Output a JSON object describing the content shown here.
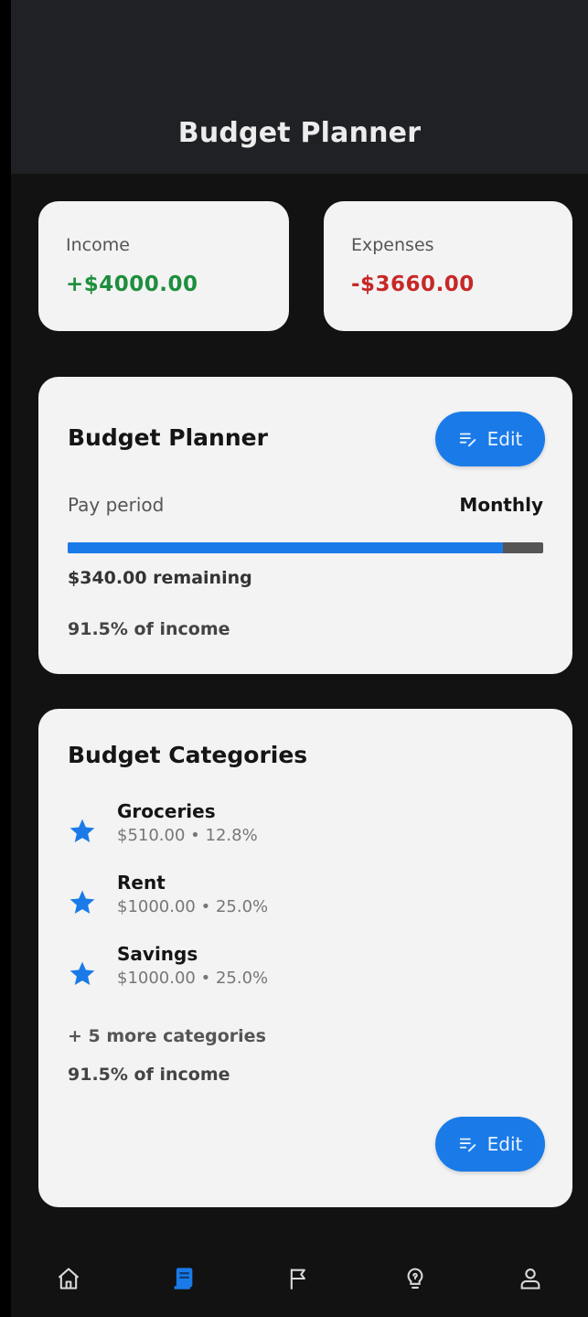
{
  "header": {
    "title": "Budget Planner"
  },
  "summary": {
    "income": {
      "label": "Income",
      "value": "+$4000.00",
      "color": "#1e8e3e"
    },
    "expenses": {
      "label": "Expenses",
      "value": "-$3660.00",
      "color": "#c62828"
    }
  },
  "planner": {
    "title": "Budget Planner",
    "edit_label": "Edit",
    "pay_period_label": "Pay period",
    "pay_period_value": "Monthly",
    "progress_fraction": 0.915,
    "remaining": "$340.00 remaining",
    "percent_of_income": "91.5% of income"
  },
  "categories": {
    "title": "Budget Categories",
    "items": [
      {
        "name": "Groceries",
        "detail": "$510.00 • 12.8%",
        "icon": "star-icon"
      },
      {
        "name": "Rent",
        "detail": "$1000.00 • 25.0%",
        "icon": "star-icon"
      },
      {
        "name": "Savings",
        "detail": "$1000.00 • 25.0%",
        "icon": "star-icon"
      }
    ],
    "more": "+ 5 more categories",
    "percent_of_income": "91.5% of income",
    "edit_label": "Edit"
  },
  "nav": {
    "items": [
      {
        "name": "home",
        "icon": "home-icon",
        "active": false
      },
      {
        "name": "budget",
        "icon": "budget-book-icon",
        "active": true
      },
      {
        "name": "goals",
        "icon": "flag-icon",
        "active": false
      },
      {
        "name": "tips",
        "icon": "lightbulb-icon",
        "active": false
      },
      {
        "name": "profile",
        "icon": "user-icon",
        "active": false
      }
    ],
    "active_color": "#1a7be8",
    "inactive_color": "#d8d8d8"
  },
  "colors": {
    "accent": "#1a7be8",
    "card": "#f3f3f3",
    "background": "#121212"
  }
}
